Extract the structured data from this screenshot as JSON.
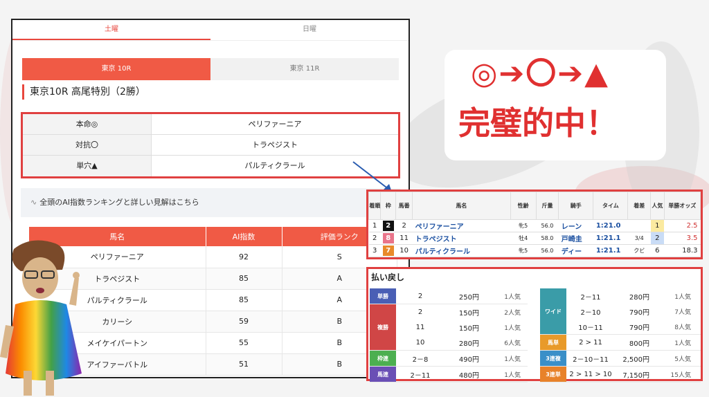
{
  "day_tabs": [
    "土曜",
    "日曜"
  ],
  "race_tabs": [
    "東京 10R",
    "東京 11R"
  ],
  "race_title": "東京10R 高尾特別（2勝）",
  "picks": [
    {
      "label": "本命◎",
      "value": "ペリファーニア"
    },
    {
      "label": "対抗〇",
      "value": "トラペジスト"
    },
    {
      "label": "単穴▲",
      "value": "パルティクラール"
    }
  ],
  "link_text": "全頭のAI指数ランキングと詳しい見解はこちら",
  "ranking": {
    "headers": [
      "馬名",
      "AI指数",
      "評価ランク"
    ],
    "rows": [
      [
        "ペリファーニア",
        "92",
        "S"
      ],
      [
        "トラペジスト",
        "85",
        "A"
      ],
      [
        "パルティクラール",
        "85",
        "A"
      ],
      [
        "カリーシ",
        "59",
        "B"
      ],
      [
        "メイケイパートン",
        "55",
        "B"
      ],
      [
        "アイファーバトル",
        "51",
        "B"
      ]
    ]
  },
  "callout": {
    "symbols": "◎➔〇➔▲",
    "hit_text": "完璧的中！"
  },
  "result": {
    "headers": [
      "着順",
      "枠",
      "馬番",
      "馬名",
      "性齢",
      "斤量",
      "騎手",
      "タイム",
      "着差",
      "人気",
      "単勝オッズ"
    ],
    "rows": [
      {
        "rank": "1",
        "waku": "2",
        "waku_color": "#111111",
        "num": "2",
        "name": "ペリファーニア",
        "sex_age": "牝5",
        "weight": "56.0",
        "jockey": "レーン",
        "time": "1:21.0",
        "margin": "",
        "pop": "1",
        "pop_color": "#fbeaa0",
        "odds": "2.5",
        "odds_color": "#d03030"
      },
      {
        "rank": "2",
        "waku": "8",
        "waku_color": "#e9748a",
        "num": "11",
        "name": "トラペジスト",
        "sex_age": "牡4",
        "weight": "58.0",
        "jockey": "戸崎圭",
        "time": "1:21.1",
        "margin": "3/4",
        "pop": "2",
        "pop_color": "#c9dcf6",
        "odds": "3.5",
        "odds_color": "#d03030"
      },
      {
        "rank": "3",
        "waku": "7",
        "waku_color": "#e88a2a",
        "num": "10",
        "name": "パルティクラール",
        "sex_age": "牝5",
        "weight": "56.0",
        "jockey": "ディー",
        "time": "1:21.1",
        "margin": "クビ",
        "pop": "6",
        "pop_color": "#ffffff",
        "odds": "18.3",
        "odds_color": "#222222"
      }
    ]
  },
  "payout": {
    "title": "払い戻し",
    "left": [
      {
        "type": "単勝",
        "color": "#4a5fb5",
        "lines": [
          [
            "2",
            "250円",
            "1人気"
          ]
        ]
      },
      {
        "type": "複勝",
        "color": "#d04646",
        "lines": [
          [
            "2",
            "150円",
            "2人気"
          ],
          [
            "11",
            "150円",
            "1人気"
          ],
          [
            "10",
            "280円",
            "6人気"
          ]
        ]
      },
      {
        "type": "枠連",
        "color": "#4caf50",
        "lines": [
          [
            "2－8",
            "490円",
            "1人気"
          ]
        ]
      },
      {
        "type": "馬連",
        "color": "#6a4fb5",
        "lines": [
          [
            "2－11",
            "480円",
            "1人気"
          ]
        ]
      }
    ],
    "right": [
      {
        "type": "ワイド",
        "color": "#3a9ca8",
        "lines": [
          [
            "2－11",
            "280円",
            "1人気"
          ],
          [
            "2－10",
            "790円",
            "7人気"
          ],
          [
            "10－11",
            "790円",
            "8人気"
          ]
        ]
      },
      {
        "type": "馬単",
        "color": "#e89a2a",
        "lines": [
          [
            "2 > 11",
            "800円",
            "1人気"
          ]
        ]
      },
      {
        "type": "3連複",
        "color": "#3a8fc8",
        "lines": [
          [
            "2－10－11",
            "2,500円",
            "5人気"
          ]
        ]
      },
      {
        "type": "3連単",
        "color": "#e8822a",
        "lines": [
          [
            "2 > 11 > 10",
            "7,150円",
            "15人気"
          ]
        ]
      }
    ]
  },
  "colors": {
    "accent": "#f05a45",
    "highlight_red": "#e03030"
  }
}
